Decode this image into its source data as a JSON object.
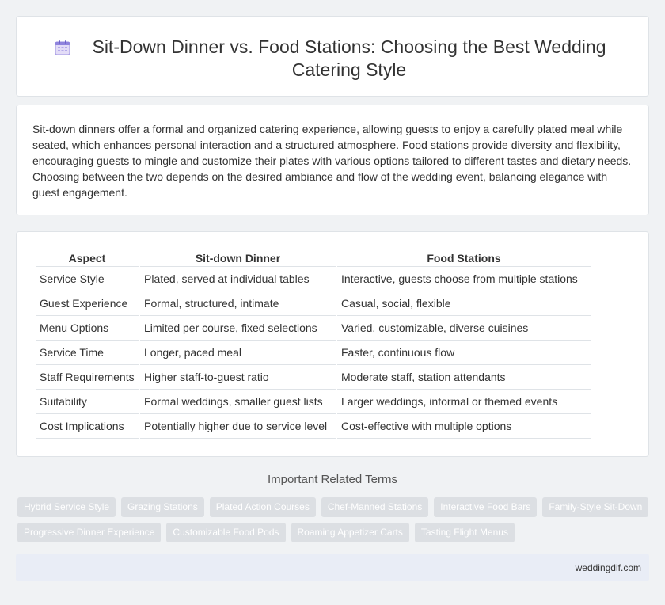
{
  "header": {
    "title": "Sit-Down Dinner vs. Food Stations: Choosing the Best Wedding Catering Style",
    "icon": "calendar-icon"
  },
  "intro": {
    "text": "Sit-down dinners offer a formal and organized catering experience, allowing guests to enjoy a carefully plated meal while seated, which enhances personal interaction and a structured atmosphere. Food stations provide diversity and flexibility, encouraging guests to mingle and customize their plates with various options tailored to different tastes and dietary needs. Choosing between the two depends on the desired ambiance and flow of the wedding event, balancing elegance with guest engagement."
  },
  "table": {
    "headers": [
      "Aspect",
      "Sit-down Dinner",
      "Food Stations"
    ],
    "rows": [
      [
        "Service Style",
        "Plated, served at individual tables",
        "Interactive, guests choose from multiple stations"
      ],
      [
        "Guest Experience",
        "Formal, structured, intimate",
        "Casual, social, flexible"
      ],
      [
        "Menu Options",
        "Limited per course, fixed selections",
        "Varied, customizable, diverse cuisines"
      ],
      [
        "Service Time",
        "Longer, paced meal",
        "Faster, continuous flow"
      ],
      [
        "Staff Requirements",
        "Higher staff-to-guest ratio",
        "Moderate staff, station attendants"
      ],
      [
        "Suitability",
        "Formal weddings, smaller guest lists",
        "Larger weddings, informal or themed events"
      ],
      [
        "Cost Implications",
        "Potentially higher due to service level",
        "Cost-effective with multiple options"
      ]
    ]
  },
  "related": {
    "title": "Important Related Terms",
    "tags_row1": [
      "Hybrid Service Style",
      "Grazing Stations",
      "Plated Action Courses",
      "Chef-Manned Stations",
      "Interactive Food Bars",
      "Family-Style Sit-Down"
    ],
    "tags_row2": [
      "Progressive Dinner Experience",
      "Customizable Food Pods",
      "Roaming Appetizer Carts",
      "Tasting Flight Menus"
    ]
  },
  "footer": {
    "site": "weddingdif.com"
  },
  "colors": {
    "page_bg": "#f0f2f4",
    "card_bg": "#ffffff",
    "tag_bg": "#dcdfe3",
    "footer_bg": "#e9edf6",
    "icon_purple": "#7b6fd6"
  }
}
